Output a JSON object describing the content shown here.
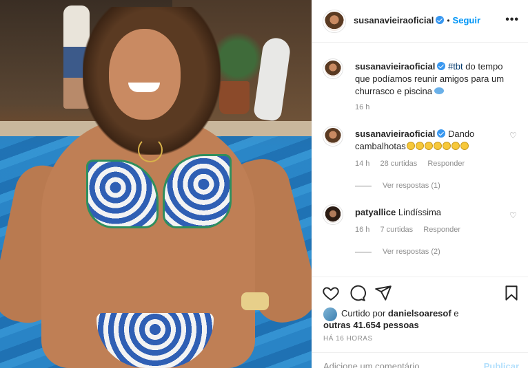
{
  "post": {
    "username": "susanavieiraoficial",
    "follow_label": "Seguir",
    "more_label": "•••",
    "dot": "•"
  },
  "caption": {
    "username": "susanavieiraoficial",
    "hashtag": "#tbt",
    "text": " do tempo que podíamos reunir amigos para um churrasco e piscina",
    "time": "16 h"
  },
  "comments": [
    {
      "username": "susanavieiraoficial",
      "text": "Dando cambalhotas",
      "time": "14 h",
      "likes": "28 curtidas",
      "reply": "Responder",
      "view_replies": "Ver respostas (1)"
    },
    {
      "username": "patyallice",
      "text": "Lindíssima",
      "time": "16 h",
      "likes": "7 curtidas",
      "reply": "Responder",
      "view_replies": "Ver respostas (2)"
    }
  ],
  "likes": {
    "prefix": "Curtido por ",
    "user": "danielsoaresof",
    "mid": " e ",
    "others": "outras 41.654 pessoas"
  },
  "timestamp": "HÁ 16 HORAS",
  "add_comment": {
    "placeholder": "Adicione um comentário...",
    "publish": "Publicar"
  },
  "icons": [
    "heart-icon",
    "comment-icon",
    "share-icon",
    "bookmark-icon",
    "verified-icon"
  ],
  "colors": {
    "link": "#0095f6",
    "muted": "#8e8e8e",
    "verified": "#3897f0"
  }
}
